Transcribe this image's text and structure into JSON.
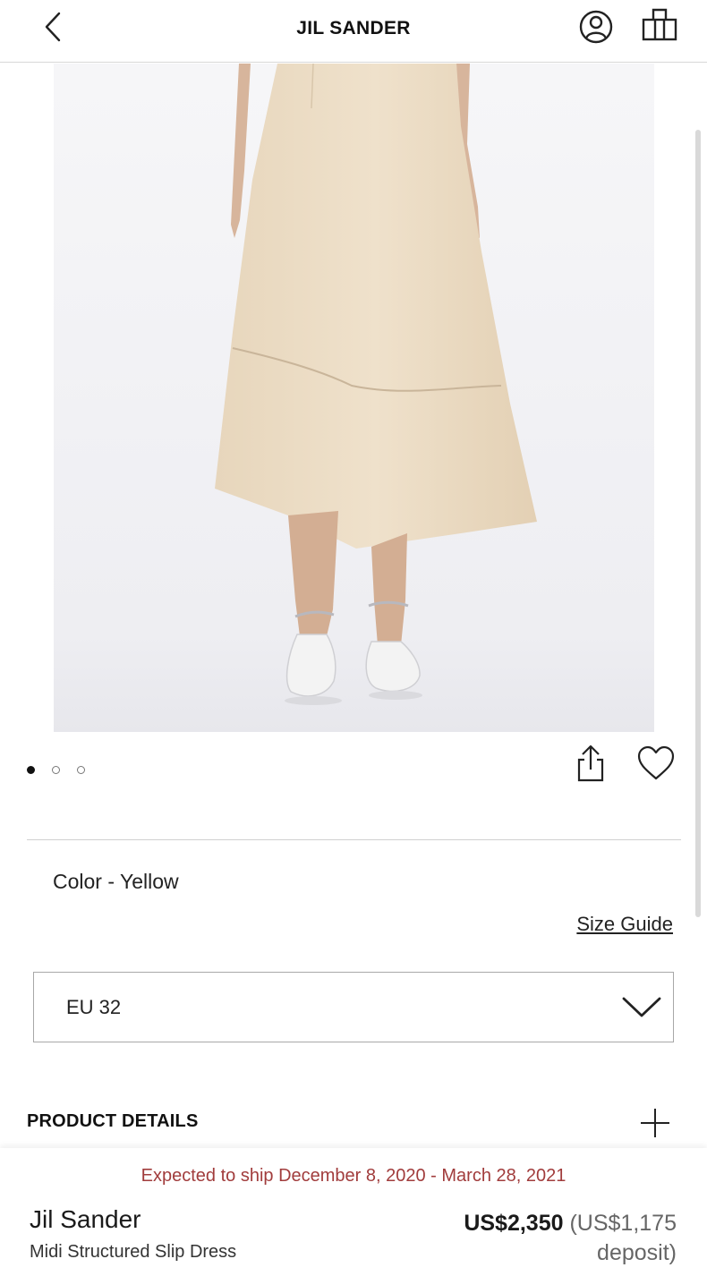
{
  "header": {
    "brand": "JIL SANDER",
    "icons": {
      "back": "chevron-left-icon",
      "account": "user-circle-icon",
      "bag": "shopping-bag-icon"
    }
  },
  "gallery": {
    "slide_count": 3,
    "active_slide": 1,
    "image_alt": "Model wearing a beige midi skirt with white flat shoes",
    "icons": {
      "share": "share-icon",
      "wishlist": "heart-icon"
    }
  },
  "options": {
    "color_label": "Color - Yellow",
    "size_guide": "Size Guide",
    "size_selected": "EU 32"
  },
  "details": {
    "title": "PRODUCT DETAILS"
  },
  "purchase": {
    "ship_note": "Expected to ship December 8, 2020 - March 28, 2021",
    "brand": "Jil Sander",
    "name": "Midi Structured Slip Dress",
    "price": "US$2,350",
    "deposit": "(US$1,175 deposit)"
  },
  "colors": {
    "ship_note": "#a13c3c",
    "fabric": "#ecdcc3",
    "text": "#1a1a1a"
  }
}
